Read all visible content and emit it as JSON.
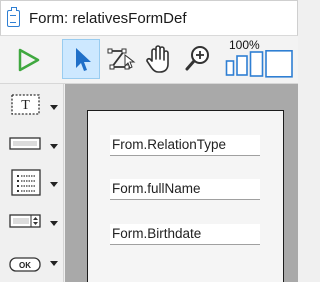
{
  "window": {
    "title": "Form: relativesFormDef"
  },
  "toolbar": {
    "zoom_level": "100%",
    "tools": [
      {
        "name": "run",
        "icon": "play-icon",
        "active": false
      },
      {
        "name": "select",
        "icon": "pointer-arrow-icon",
        "active": true
      },
      {
        "name": "reshape",
        "icon": "reshape-icon",
        "active": false
      },
      {
        "name": "pan",
        "icon": "hand-icon",
        "active": false
      },
      {
        "name": "zoom",
        "icon": "magnifier-plus-icon",
        "active": false
      }
    ],
    "zoom_presets": [
      "small",
      "medium",
      "large",
      "extra-large"
    ]
  },
  "palette": {
    "items": [
      {
        "icon": "text-label-icon",
        "glyph": "T"
      },
      {
        "icon": "text-field-icon"
      },
      {
        "icon": "list-box-icon"
      },
      {
        "icon": "spinner-field-icon"
      },
      {
        "icon": "button-control-icon",
        "glyph": "OK"
      }
    ]
  },
  "form": {
    "fields": [
      {
        "value": "From.RelationType"
      },
      {
        "value": "Form.fullName"
      },
      {
        "value": "Form.Birthdate"
      }
    ]
  },
  "colors": {
    "accent": "#2f7fd3",
    "play": "#3fa83f",
    "selected_bg": "#cde8ff",
    "canvas_bg": "#a9a9a9"
  }
}
